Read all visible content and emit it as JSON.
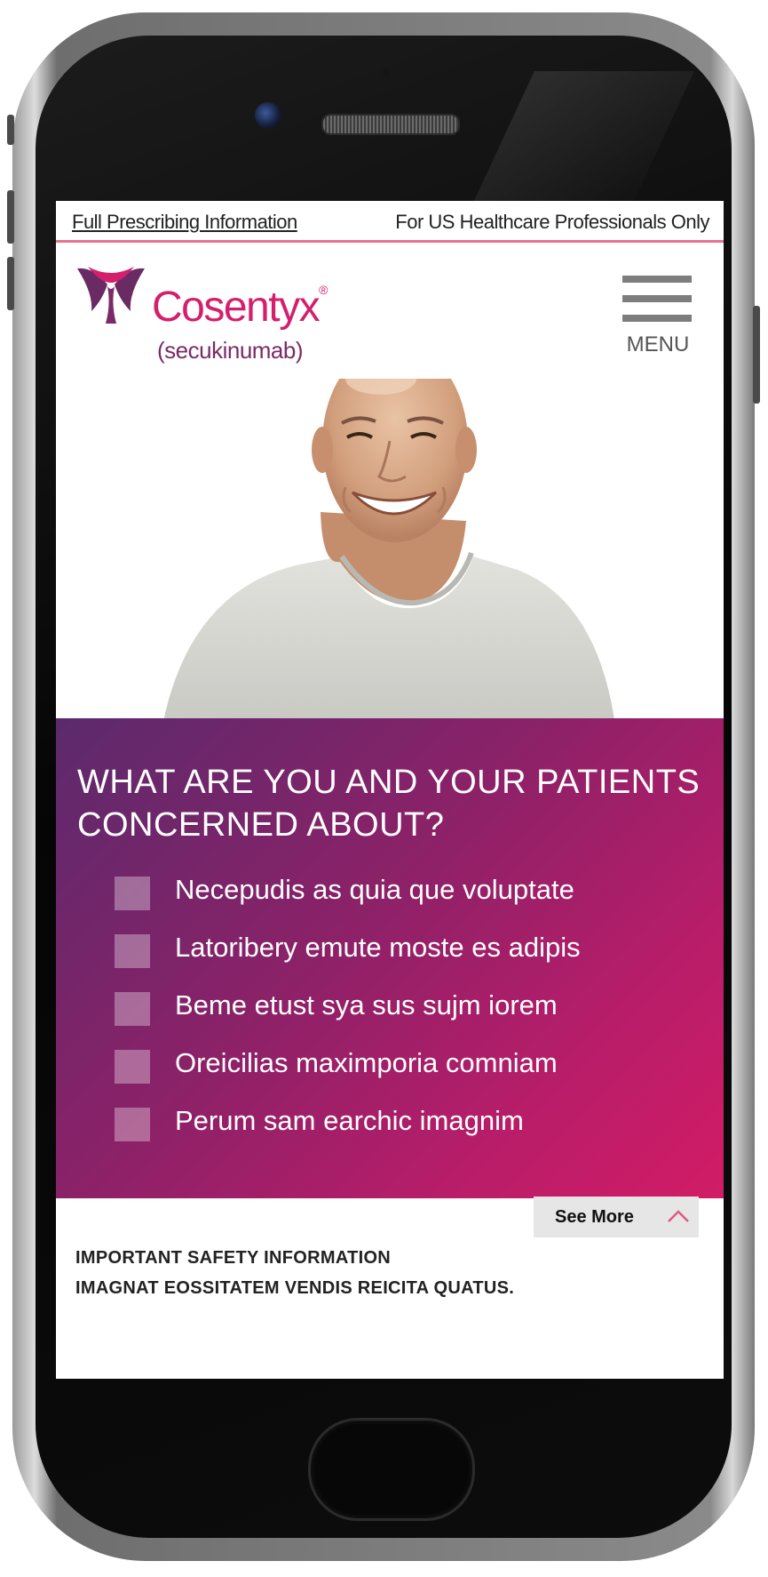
{
  "header": {
    "prescribing_link": "Full Prescribing Information",
    "audience_notice": "For US Healthcare Professionals Only"
  },
  "brand": {
    "name": "Cosentyx",
    "registered_mark": "®",
    "generic_name": "(secukinumab)",
    "primary_color": "#d41f6d",
    "secondary_color": "#7a2a67",
    "logo_icon": "cosentyx-logo-icon"
  },
  "nav": {
    "menu_label": "MENU",
    "menu_icon": "hamburger-icon"
  },
  "hero": {
    "image": "smiling-man-photo"
  },
  "concerns_panel": {
    "title": "WHAT ARE YOU AND YOUR PATIENTS CONCERNED ABOUT?",
    "items": [
      {
        "label": "Necepudis as quia que voluptate",
        "checked": false
      },
      {
        "label": "Latoribery emute moste es adipis",
        "checked": false
      },
      {
        "label": "Beme etust sya sus sujm iorem",
        "checked": false
      },
      {
        "label": "Oreicilias maximporia comniam",
        "checked": false
      },
      {
        "label": "Perum sam earchic imagnim",
        "checked": false
      }
    ],
    "gradient_start": "#5b2a6c",
    "gradient_end": "#d21c66"
  },
  "see_more": {
    "label": "See More",
    "icon": "chevron-up-icon",
    "icon_color": "#e05a7e"
  },
  "safety": {
    "heading": "IMPORTANT SAFETY INFORMATION",
    "text": "IMAGNAT EOSSITATEM VENDIS REICITA QUATUS."
  }
}
